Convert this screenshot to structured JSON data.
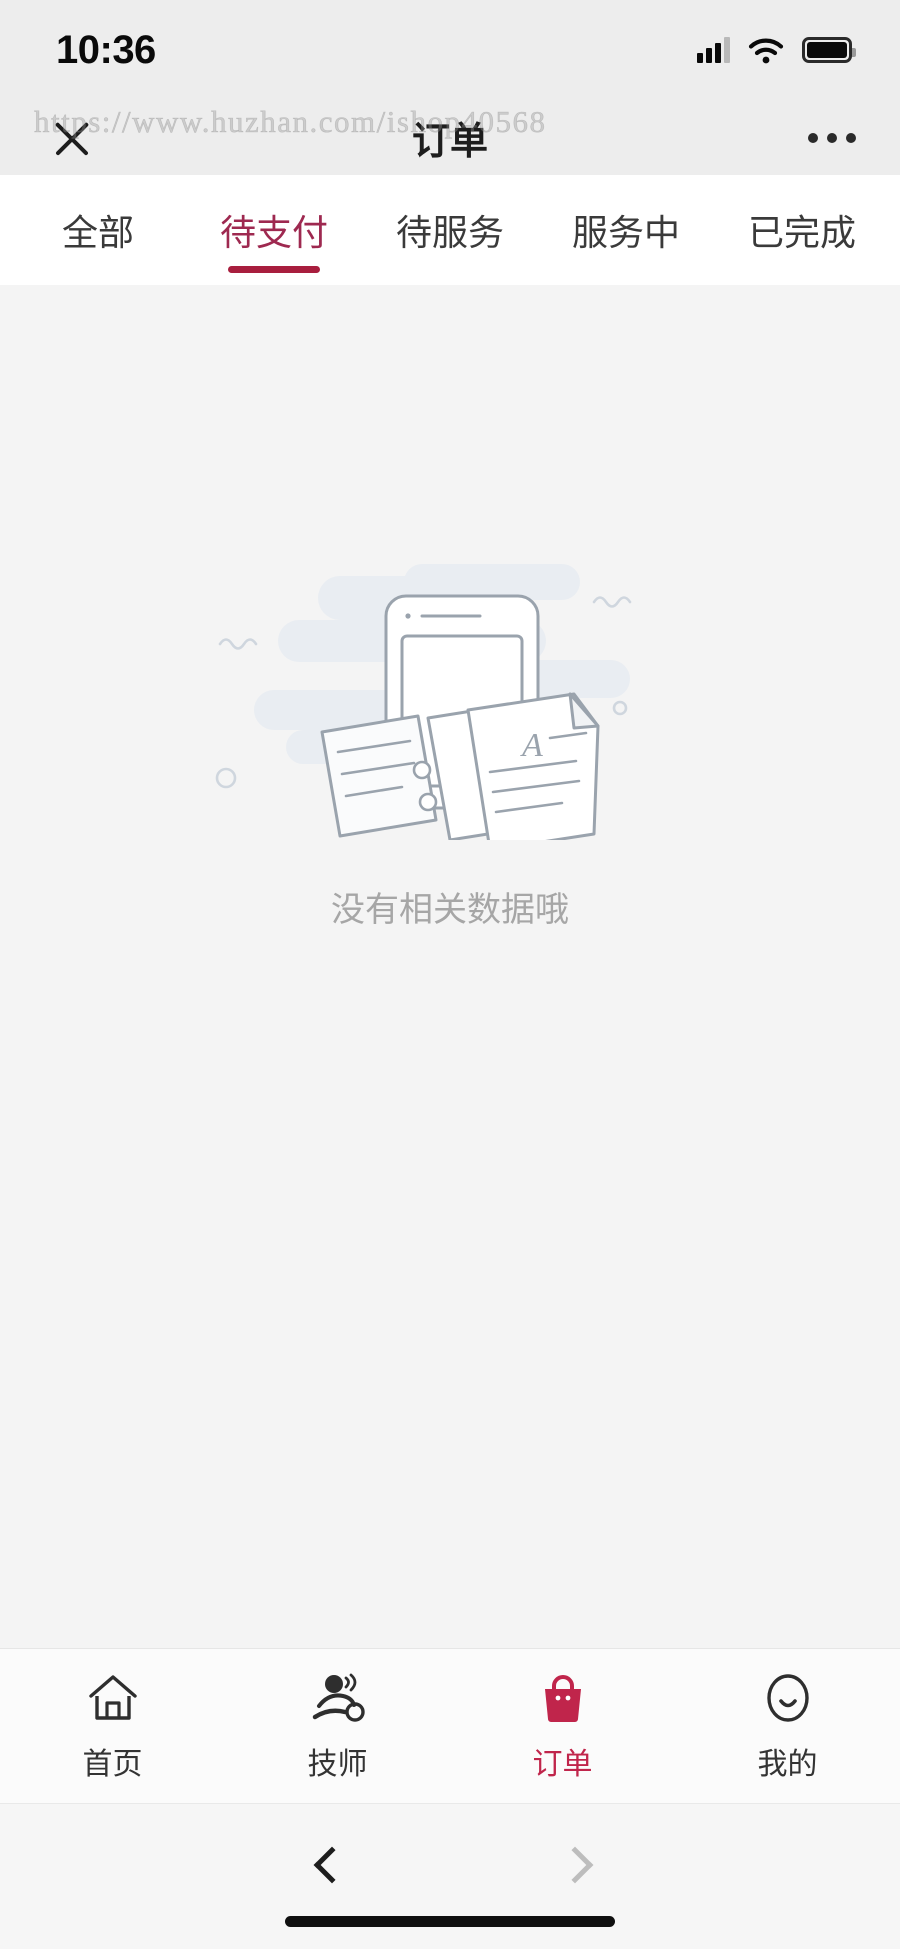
{
  "statusbar": {
    "time": "10:36",
    "signal_icon": "signal-bars-icon",
    "wifi_icon": "wifi-icon",
    "battery_icon": "battery-icon"
  },
  "header": {
    "title": "订单",
    "close_icon": "close-icon",
    "more_icon": "more-options-icon",
    "watermark": "https://www.huzhan.com/ishop40568"
  },
  "tabs": {
    "items": [
      {
        "label": "全部",
        "active": false
      },
      {
        "label": "待支付",
        "active": true
      },
      {
        "label": "待服务",
        "active": false
      },
      {
        "label": "服务中",
        "active": false
      },
      {
        "label": "已完成",
        "active": false
      }
    ],
    "active_color": "#9e2950",
    "indicator_color": "#a81e3e"
  },
  "empty_state": {
    "message": "没有相关数据哦",
    "illustration": "empty-documents-phone-illustration"
  },
  "tabbar": {
    "items": [
      {
        "label": "首页",
        "icon": "home-icon",
        "active": false
      },
      {
        "label": "技师",
        "icon": "masseur-icon",
        "active": false
      },
      {
        "label": "订单",
        "icon": "shopping-bag-icon",
        "active": true
      },
      {
        "label": "我的",
        "icon": "profile-smiley-icon",
        "active": false
      }
    ],
    "active_color": "#c0254b"
  },
  "browserbar": {
    "back_icon": "chevron-left-icon",
    "forward_icon": "chevron-right-icon",
    "back_enabled": "true",
    "forward_enabled": "false"
  }
}
